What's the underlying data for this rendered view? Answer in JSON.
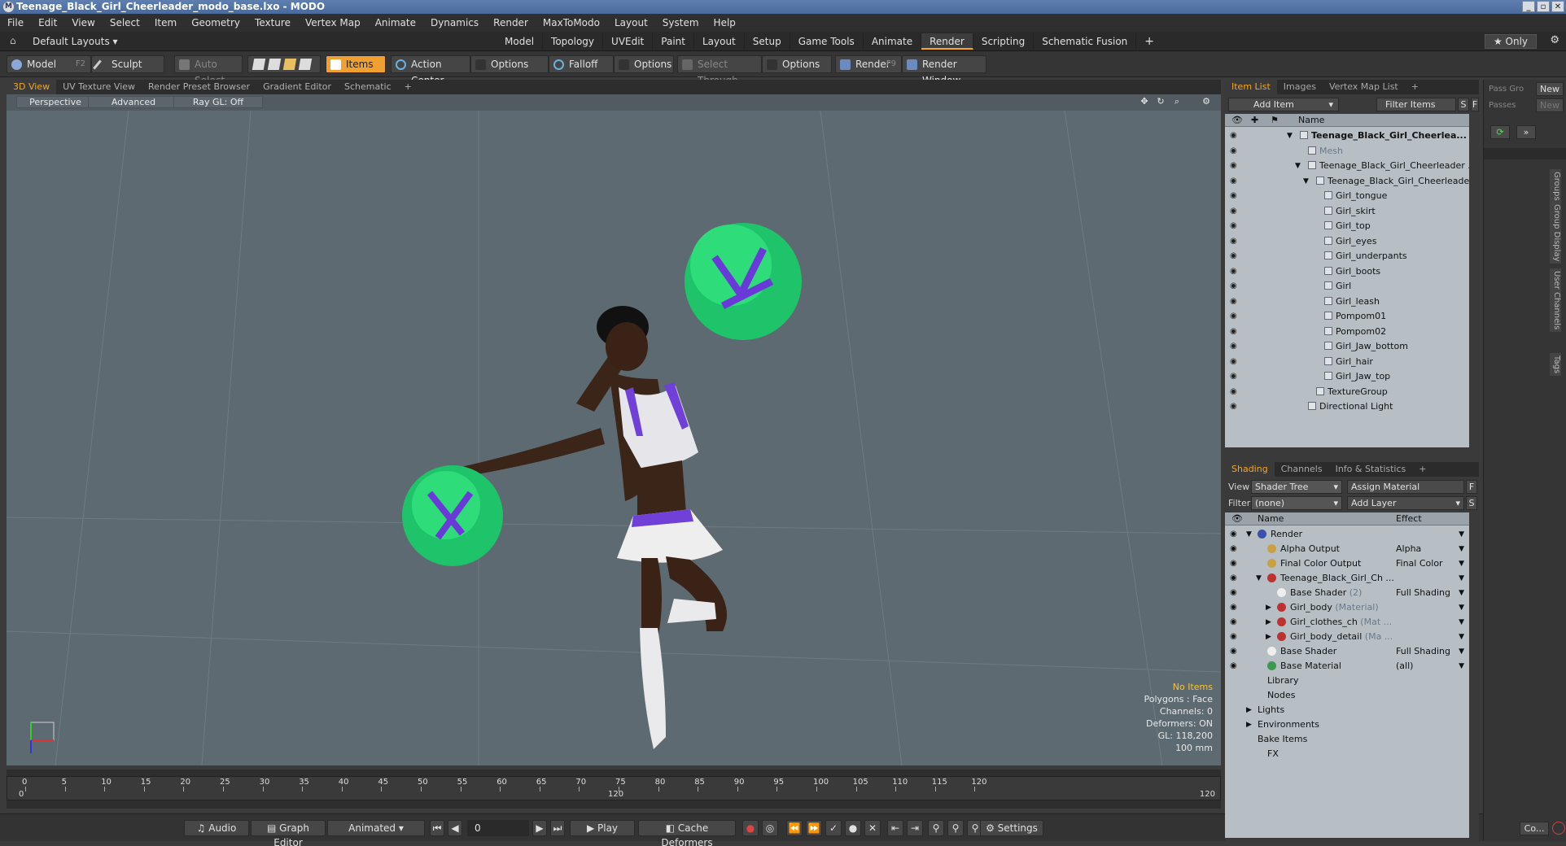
{
  "window": {
    "title": "Teenage_Black_Girl_Cheerleader_modo_base.lxo - MODO",
    "controls": [
      "_",
      "▫",
      "✕"
    ]
  },
  "menu": [
    "File",
    "Edit",
    "View",
    "Select",
    "Item",
    "Geometry",
    "Texture",
    "Vertex Map",
    "Animate",
    "Dynamics",
    "Render",
    "MaxToModo",
    "Layout",
    "System",
    "Help"
  ],
  "layoutbar": {
    "layout_label": "Default Layouts ▾",
    "tabs": [
      "Model",
      "Topology",
      "UVEdit",
      "Paint",
      "Layout",
      "Setup",
      "Game Tools",
      "Animate",
      "Render",
      "Scripting",
      "Schematic Fusion"
    ],
    "active_tab": "Render",
    "plus": "+",
    "only_label": "★ Only"
  },
  "toolbar": {
    "model": "Model",
    "model_key": "F2",
    "sculpt": "Sculpt",
    "auto_select": "Auto Select",
    "items": "Items",
    "action_center": "Action Center",
    "options1": "Options",
    "falloff": "Falloff",
    "options2": "Options",
    "select_through": "Select Through",
    "options3": "Options",
    "render": "Render",
    "render_key": "F9",
    "render_window": "Render Window"
  },
  "viewport": {
    "tabs": [
      "3D View",
      "UV Texture View",
      "Render Preset Browser",
      "Gradient Editor",
      "Schematic",
      "+"
    ],
    "active_tab": "3D View",
    "perspective": "Perspective",
    "advanced": "Advanced",
    "raygl": "Ray GL: Off",
    "stats": {
      "no_items": "No Items",
      "polygons": "Polygons : Face",
      "channels": "Channels: 0",
      "deformers": "Deformers: ON",
      "gl": "GL: 118,200",
      "size": "100 mm"
    }
  },
  "timeline": {
    "ticks": [
      "0",
      "5",
      "10",
      "15",
      "20",
      "25",
      "30",
      "35",
      "40",
      "45",
      "50",
      "55",
      "60",
      "65",
      "70",
      "75",
      "80",
      "85",
      "90",
      "95",
      "100",
      "105",
      "110",
      "115",
      "120"
    ],
    "start": "0",
    "mid": "120",
    "end": "120"
  },
  "bottombar": {
    "audio": "Audio",
    "graph_editor": "Graph Editor",
    "animated": "Animated",
    "frame": "0",
    "play": "Play",
    "cache_deformers": "Cache Deformers",
    "settings": "Settings"
  },
  "itemlist": {
    "tabs": [
      "Item List",
      "Images",
      "Vertex Map List",
      "+"
    ],
    "active_tab": "Item List",
    "add_item": "Add Item",
    "filter_items": "Filter Items",
    "s": "S",
    "f": "F",
    "name_header": "Name",
    "rows": [
      {
        "label": "Teenage_Black_Girl_Cheerlea...",
        "indent": 0,
        "bold": true,
        "arrow": "▼"
      },
      {
        "label": "Mesh",
        "indent": 1,
        "dim": true
      },
      {
        "label": "Teenage_Black_Girl_Cheerleader ...",
        "indent": 1,
        "arrow": "▼"
      },
      {
        "label": "Teenage_Black_Girl_Cheerleader",
        "indent": 2,
        "arrow": "▼"
      },
      {
        "label": "Girl_tongue",
        "indent": 3
      },
      {
        "label": "Girl_skirt",
        "indent": 3
      },
      {
        "label": "Girl_top",
        "indent": 3
      },
      {
        "label": "Girl_eyes",
        "indent": 3
      },
      {
        "label": "Girl_underpants",
        "indent": 3
      },
      {
        "label": "Girl_boots",
        "indent": 3
      },
      {
        "label": "Girl",
        "indent": 3
      },
      {
        "label": "Girl_leash",
        "indent": 3
      },
      {
        "label": "Pompom01",
        "indent": 3
      },
      {
        "label": "Pompom02",
        "indent": 3
      },
      {
        "label": "Girl_Jaw_bottom",
        "indent": 3
      },
      {
        "label": "Girl_hair",
        "indent": 3
      },
      {
        "label": "Girl_Jaw_top",
        "indent": 3
      },
      {
        "label": "TextureGroup",
        "indent": 2
      },
      {
        "label": "Directional Light",
        "indent": 1
      }
    ]
  },
  "shading": {
    "tabs": [
      "Shading",
      "Channels",
      "Info & Statistics",
      "+"
    ],
    "active_tab": "Shading",
    "view_label": "View",
    "view_value": "Shader Tree",
    "assign_material": "Assign Material",
    "f": "F",
    "filter_label": "Filter",
    "filter_value": "(none)",
    "add_layer": "Add Layer",
    "s": "S",
    "name_header": "Name",
    "effect_header": "Effect",
    "rows": [
      {
        "name": "Render",
        "effect": "",
        "indent": 0,
        "ball": "#3a4fb0",
        "arrow": "▼"
      },
      {
        "name": "Alpha Output",
        "effect": "Alpha",
        "indent": 1,
        "ball": "#caa040"
      },
      {
        "name": "Final Color Output",
        "effect": "Final Color",
        "indent": 1,
        "ball": "#caa040"
      },
      {
        "name": "Teenage_Black_Girl_Ch ...",
        "effect": "",
        "indent": 1,
        "ball": "#c03030",
        "arrow": "▼"
      },
      {
        "name": "Base Shader",
        "sub": "(2)",
        "effect": "Full Shading",
        "indent": 2,
        "ball": "#eeeeee"
      },
      {
        "name": "Girl_body",
        "sub": "(Material)",
        "effect": "",
        "indent": 2,
        "ball": "#c03030",
        "arrow": "▶"
      },
      {
        "name": "Girl_clothes_ch",
        "sub": "(Mat ...",
        "effect": "",
        "indent": 2,
        "ball": "#c03030",
        "arrow": "▶"
      },
      {
        "name": "Girl_body_detail",
        "sub": "(Ma ...",
        "effect": "",
        "indent": 2,
        "ball": "#c03030",
        "arrow": "▶"
      },
      {
        "name": "Base Shader",
        "effect": "Full Shading",
        "indent": 1,
        "ball": "#eeeeee"
      },
      {
        "name": "Base Material",
        "effect": "(all)",
        "indent": 1,
        "ball": "#3a9a50"
      },
      {
        "name": "Library",
        "effect": "",
        "indent": 1
      },
      {
        "name": "Nodes",
        "effect": "",
        "indent": 1
      },
      {
        "name": "Lights",
        "effect": "",
        "indent": 0,
        "arrow": "▶"
      },
      {
        "name": "Environments",
        "effect": "",
        "indent": 0,
        "arrow": "▶"
      },
      {
        "name": "Bake Items",
        "effect": "",
        "indent": 0
      },
      {
        "name": "FX",
        "effect": "",
        "indent": 1
      }
    ]
  },
  "farpanel": {
    "pass_group": "Pass Gro",
    "new1": "New",
    "passes": "Passes",
    "new2": "New",
    "vtabs": [
      "Groups",
      "Group Display",
      "User Channels",
      "Tags"
    ],
    "command": "Co..."
  },
  "colors": {
    "accent": "#f5a623",
    "viewport_bg": "#5e6a71",
    "pompom_green": "#2fdc7a",
    "pompom_purple": "#6a3ad8"
  }
}
